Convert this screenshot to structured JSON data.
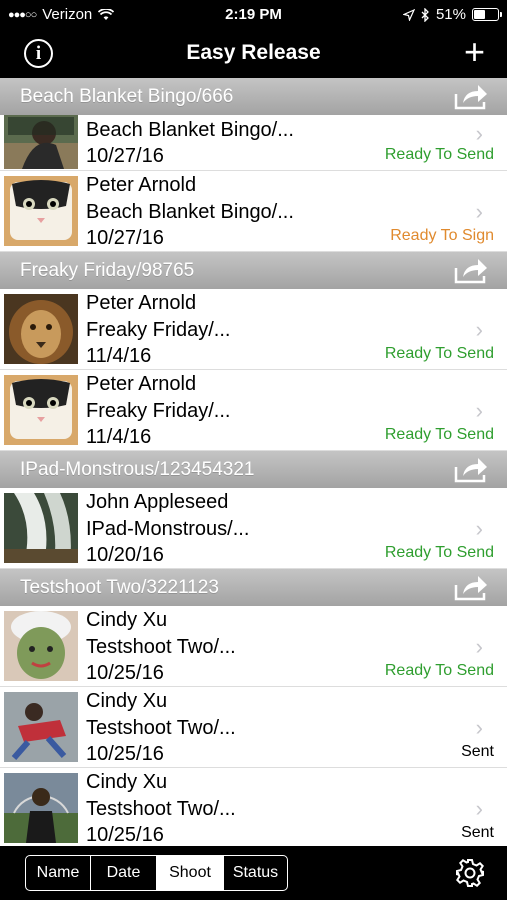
{
  "status_bar": {
    "signal": "●●●○○",
    "carrier": "Verizon",
    "time": "2:19 PM",
    "battery": "51%",
    "battery_level": 0.51
  },
  "nav": {
    "title": "Easy Release",
    "info": "i",
    "add": "+"
  },
  "sections": [
    {
      "title": "Beach Blanket Bingo/666",
      "rows": [
        {
          "name": "",
          "shoot": "Beach Blanket Bingo/...",
          "date": "10/27/16",
          "status": "Ready To Send"
        },
        {
          "name": "Peter Arnold",
          "shoot": "Beach Blanket Bingo/...",
          "date": "10/27/16",
          "status": "Ready To Sign"
        }
      ]
    },
    {
      "title": "Freaky Friday/98765",
      "rows": [
        {
          "name": "Peter Arnold",
          "shoot": "Freaky Friday/...",
          "date": "11/4/16",
          "status": "Ready To Send"
        },
        {
          "name": "Peter Arnold",
          "shoot": "Freaky Friday/...",
          "date": "11/4/16",
          "status": "Ready To Send"
        }
      ]
    },
    {
      "title": "IPad-Monstrous/123454321",
      "rows": [
        {
          "name": "John Appleseed",
          "shoot": "IPad-Monstrous/...",
          "date": "10/20/16",
          "status": "Ready To Send"
        }
      ]
    },
    {
      "title": "Testshoot Two/3221123",
      "rows": [
        {
          "name": "Cindy Xu",
          "shoot": "Testshoot Two/...",
          "date": "10/25/16",
          "status": "Ready To Send"
        },
        {
          "name": "Cindy Xu",
          "shoot": "Testshoot Two/...",
          "date": "10/25/16",
          "status": "Sent"
        },
        {
          "name": "Cindy Xu",
          "shoot": "Testshoot Two/...",
          "date": "10/25/16",
          "status": "Sent"
        }
      ]
    }
  ],
  "chevron": "›",
  "tabs": [
    {
      "label": "Name",
      "active": false
    },
    {
      "label": "Date",
      "active": false
    },
    {
      "label": "Shoot",
      "active": true
    },
    {
      "label": "Status",
      "active": false
    }
  ],
  "colors": {
    "ready_to_send": "#2f9e2f",
    "ready_to_sign": "#e08a2e",
    "sent": "#000000",
    "header_bg": "#b3b3b3",
    "bar_bg": "#000000"
  }
}
